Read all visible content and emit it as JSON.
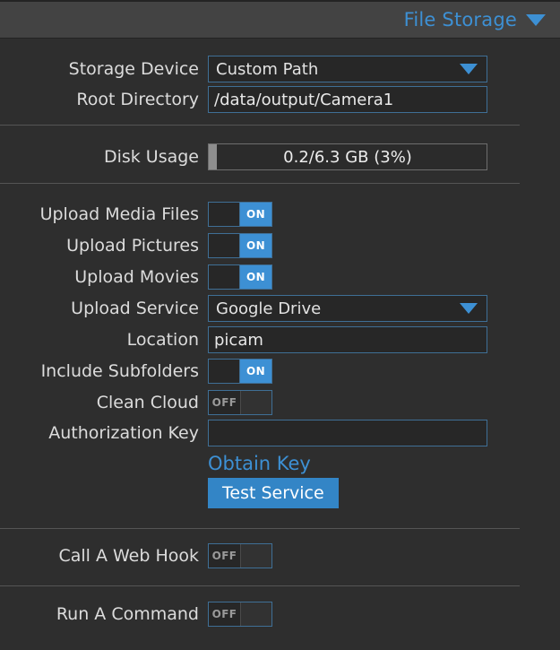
{
  "header": {
    "title": "File Storage",
    "caret": "caret-down-icon"
  },
  "rows": {
    "storage_device": {
      "label": "Storage Device",
      "value": "Custom Path"
    },
    "root_directory": {
      "label": "Root Directory",
      "value": "/data/output/Camera1",
      "placeholder": ""
    },
    "disk_usage": {
      "label": "Disk Usage",
      "text": "0.2/6.3 GB (3%)",
      "percent": 3
    },
    "upload_media_files": {
      "label": "Upload Media Files",
      "state": "ON"
    },
    "upload_pictures": {
      "label": "Upload Pictures",
      "state": "ON"
    },
    "upload_movies": {
      "label": "Upload Movies",
      "state": "ON"
    },
    "upload_service": {
      "label": "Upload Service",
      "value": "Google Drive"
    },
    "location": {
      "label": "Location",
      "value": "picam",
      "placeholder": ""
    },
    "include_subfolders": {
      "label": "Include Subfolders",
      "state": "ON"
    },
    "clean_cloud": {
      "label": "Clean Cloud",
      "state": "OFF"
    },
    "authorization_key": {
      "label": "Authorization Key",
      "value": "",
      "placeholder": ""
    },
    "call_a_web_hook": {
      "label": "Call A Web Hook",
      "state": "OFF"
    },
    "run_a_command": {
      "label": "Run A Command",
      "state": "OFF"
    }
  },
  "actions": {
    "obtain_key_link": "Obtain Key",
    "test_service_button": "Test Service"
  },
  "colors": {
    "accent": "#3d90d4",
    "panel_bg": "#2e2e2e",
    "header_bg": "#434343",
    "field_border": "#3f6f96",
    "text": "#dcdcdc"
  }
}
